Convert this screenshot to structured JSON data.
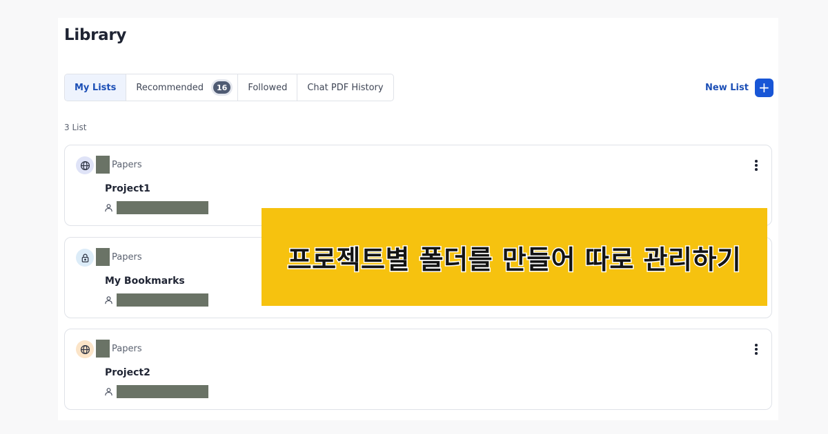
{
  "page": {
    "title": "Library"
  },
  "tabs": [
    {
      "label": "My Lists",
      "active": true
    },
    {
      "label": "Recommended",
      "badge": "16"
    },
    {
      "label": "Followed"
    },
    {
      "label": "Chat PDF History"
    }
  ],
  "new_list": {
    "label": "New List",
    "icon": "plus-icon"
  },
  "list_count": "3 List",
  "cards": [
    {
      "icon": "globe-icon",
      "paper_label": "Papers",
      "title": "Project1",
      "owner_icon": "user-icon",
      "menu_icon": "more-vertical-icon"
    },
    {
      "icon": "lock-icon",
      "paper_label": "Papers",
      "title": "My Bookmarks",
      "owner_icon": "user-icon"
    },
    {
      "icon": "globe-icon",
      "paper_label": "Papers",
      "title": "Project2",
      "owner_icon": "user-icon",
      "menu_icon": "more-vertical-icon"
    }
  ],
  "banner": {
    "text": "프로젝트별 폴더를 만들어 따로 관리하기"
  },
  "colors": {
    "accent": "#1856d6",
    "active_tab_text": "#1c4fb6",
    "banner_bg": "#f6c20f",
    "redaction": "#6a7366"
  }
}
